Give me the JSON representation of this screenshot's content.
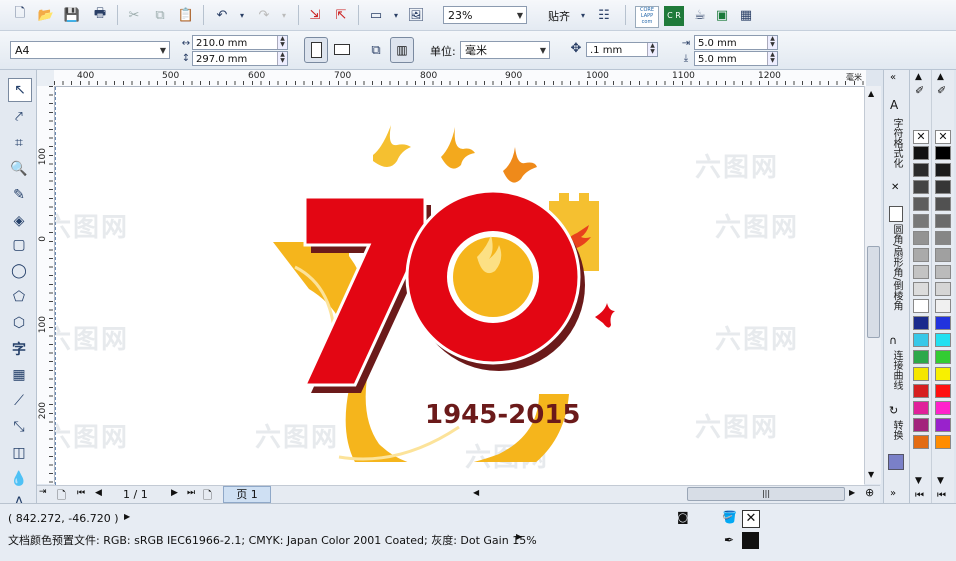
{
  "toolbar": {
    "zoom": "23%",
    "snap_label": "贴齐",
    "corel_tiles": [
      "CORE LAPP com",
      "C R"
    ]
  },
  "property_bar": {
    "page_size": "A4",
    "width": "210.0 mm",
    "height": "297.0 mm",
    "unit_label": "单位:",
    "unit": "毫米",
    "nudge": ".1 mm",
    "dup_x": "5.0 mm",
    "dup_y": "5.0 mm"
  },
  "ruler_top": {
    "unit": "毫米",
    "ticks": [
      "400",
      "500",
      "600",
      "700",
      "800",
      "900",
      "1000",
      "1100",
      "1200"
    ]
  },
  "ruler_left": {
    "ticks": [
      "100",
      "0",
      "100",
      "200"
    ]
  },
  "artwork": {
    "number": "70",
    "years": "1945-2015"
  },
  "page_nav": {
    "counter": "1 / 1",
    "page_tab": "页 1"
  },
  "status": {
    "coords": "( 842.272, -46.720 )",
    "color_profile": "文档颜色预置文件: RGB: sRGB IEC61966-2.1; CMYK: Japan Color 2001 Coated; 灰度: Dot Gain 15%"
  },
  "dock_tabs": [
    "字符格式化",
    "圆角/扇形角/倒棱角",
    "连接曲线",
    "转换"
  ],
  "watermark": "六图网",
  "palette1": [
    "#111111",
    "#2b2b2b",
    "#444444",
    "#5e5e5e",
    "#787878",
    "#939393",
    "#aaaaaa",
    "#c3c3c3",
    "#dcdcdc",
    "#ffffff",
    "#1a2a8c",
    "#38c8e8",
    "#2da84a",
    "#f5e600",
    "#d61f1f",
    "#e0209a",
    "#a3247c",
    "#e36b12"
  ],
  "palette2": [
    "#000000",
    "#1b1b1b",
    "#363636",
    "#515151",
    "#6b6b6b",
    "#868686",
    "#a0a0a0",
    "#bbbbbb",
    "#d5d5d5",
    "#f0f0f0",
    "#2233dd",
    "#22e0f0",
    "#33cc33",
    "#f8f000",
    "#ff1111",
    "#ff22cc",
    "#9922cc",
    "#ff8c00"
  ],
  "colors": {
    "red": "#e30613",
    "dark_red": "#6b1a1a",
    "yellow": "#f5b51c",
    "orange": "#ef8a1a"
  }
}
